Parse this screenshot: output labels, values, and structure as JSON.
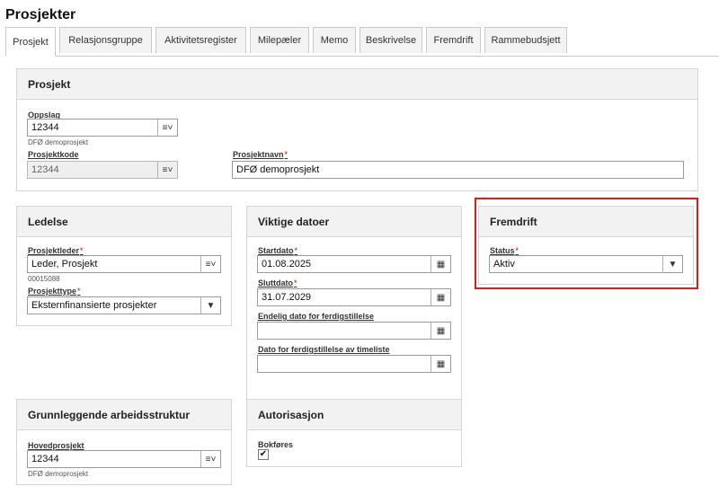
{
  "page": {
    "title": "Prosjekter"
  },
  "tabs": [
    {
      "label": "Prosjekt"
    },
    {
      "label": "Relasjonsgruppe"
    },
    {
      "label": "Aktivitetsregister"
    },
    {
      "label": "Milepæler"
    },
    {
      "label": "Memo"
    },
    {
      "label": "Beskrivelse"
    },
    {
      "label": "Fremdrift"
    },
    {
      "label": "Rammebudsjett"
    }
  ],
  "prosjekt": {
    "title": "Prosjekt",
    "oppslag_label": "Oppslag",
    "oppslag_value": "12344",
    "oppslag_desc": "DFØ demoprosjekt",
    "prosjektkode_label": "Prosjektkode",
    "prosjektkode_value": "12344",
    "prosjektnavn_label": "Prosjektnavn",
    "prosjektnavn_value": "DFØ demoprosjekt"
  },
  "ledelse": {
    "title": "Ledelse",
    "prosjektleder_label": "Prosjektleder",
    "prosjektleder_value": "Leder, Prosjekt",
    "prosjektleder_id": "00015088",
    "prosjekttype_label": "Prosjekttype",
    "prosjekttype_value": "Eksternfinansierte prosjekter"
  },
  "datoer": {
    "title": "Viktige datoer",
    "startdato_label": "Startdato",
    "startdato_value": "01.08.2025",
    "sluttdato_label": "Sluttdato",
    "sluttdato_value": "31.07.2029",
    "endelig_label": "Endelig dato for ferdigstillelse",
    "endelig_value": "",
    "timeliste_label": "Dato for ferdigstillelse av timeliste",
    "timeliste_value": ""
  },
  "fremdrift": {
    "title": "Fremdrift",
    "status_label": "Status",
    "status_value": "Aktiv"
  },
  "arbeidsstruktur": {
    "title": "Grunnleggende arbeidsstruktur",
    "hovedprosjekt_label": "Hovedprosjekt",
    "hovedprosjekt_value": "12344",
    "hovedprosjekt_desc": "DFØ demoprosjekt"
  },
  "autorisasjon": {
    "title": "Autorisasjon",
    "bokfores_label": "Bokføres",
    "bokfores_checked": true
  },
  "colors": {
    "highlight": "#e11b1b",
    "required": "#cc0000"
  },
  "icons": {
    "lookup": "list-lookup-icon",
    "calendar": "calendar-icon",
    "dropdown": "chevron-down-icon",
    "checkmark": "checkmark-icon"
  }
}
